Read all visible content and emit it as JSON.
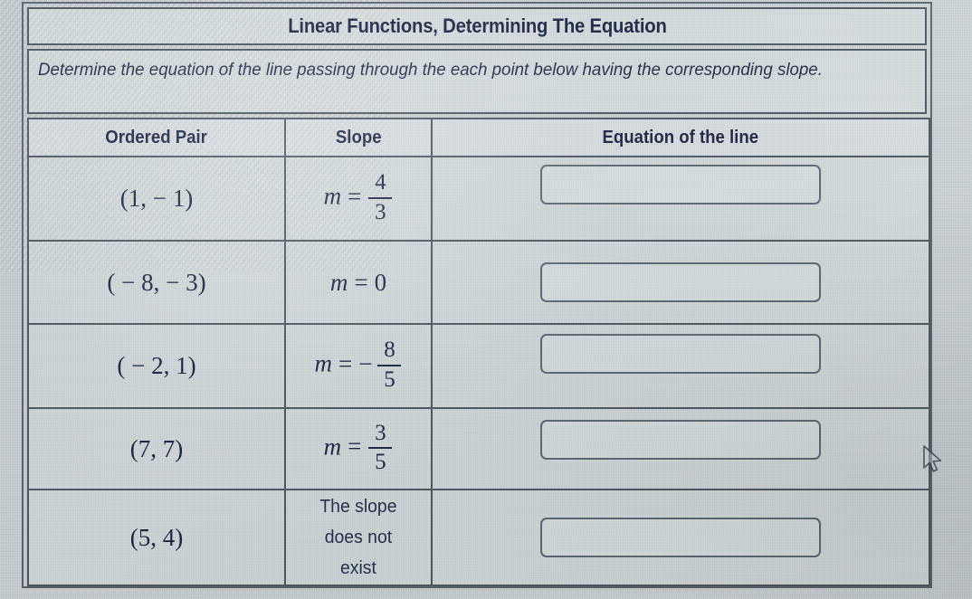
{
  "worksheet": {
    "title": "Linear Functions, Determining The Equation",
    "instructions": "Determine the equation of the line passing through the each point below having the corresponding slope.",
    "columns": {
      "ordered_pair": "Ordered Pair",
      "slope": "Slope",
      "equation": "Equation of the line"
    },
    "rows": [
      {
        "ordered_pair": "(1,  − 1)",
        "slope": {
          "kind": "fraction",
          "prefix": "m",
          "equals": "=",
          "sign": "",
          "numerator": "4",
          "denominator": "3",
          "text": "m = 4/3"
        },
        "answer": ""
      },
      {
        "ordered_pair": "( − 8,  − 3)",
        "slope": {
          "kind": "integer",
          "prefix": "m",
          "equals": "=",
          "sign": "",
          "value": "0",
          "text": "m = 0"
        },
        "answer": ""
      },
      {
        "ordered_pair": "( − 2, 1)",
        "slope": {
          "kind": "fraction",
          "prefix": "m",
          "equals": "=",
          "sign": "−",
          "numerator": "8",
          "denominator": "5",
          "text": "m = − 8/5"
        },
        "answer": ""
      },
      {
        "ordered_pair": "(7, 7)",
        "slope": {
          "kind": "fraction",
          "prefix": "m",
          "equals": "=",
          "sign": "",
          "numerator": "3",
          "denominator": "5",
          "text": "m = 3/5"
        },
        "answer": ""
      },
      {
        "ordered_pair": "(5, 4)",
        "slope": {
          "kind": "text",
          "text": "The slope does not exist",
          "line1": "The slope",
          "line2": "does not",
          "line3": "exist"
        },
        "answer": ""
      }
    ],
    "answer_placeholder": ""
  },
  "cursor": {
    "icon": "mouse-pointer-arrow"
  },
  "colors": {
    "text": "#1b2340",
    "border": "#4e5860",
    "background": "#c9ced0",
    "field_border": "#5d6872"
  }
}
